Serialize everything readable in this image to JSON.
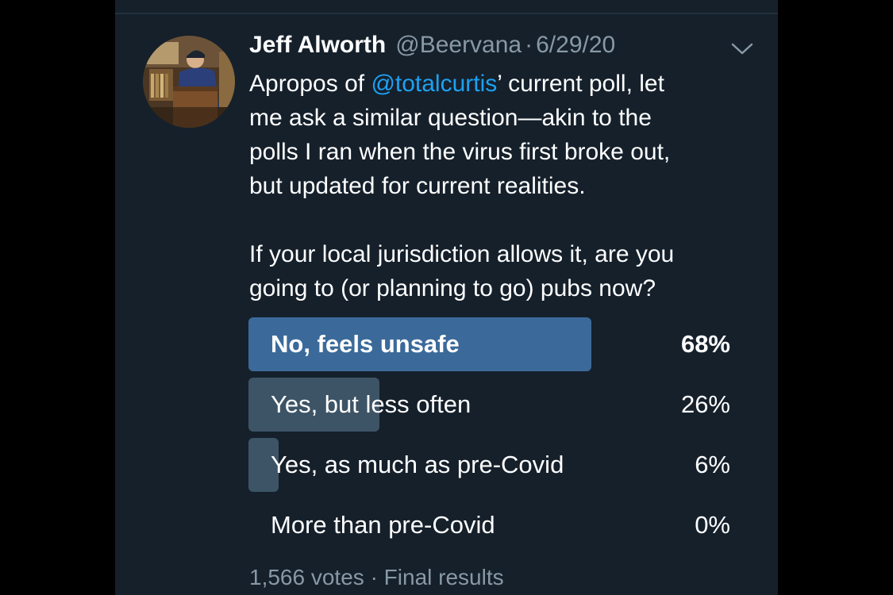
{
  "tweet": {
    "display_name": "Jeff Alworth",
    "handle": "@Beervana",
    "separator": "·",
    "date": "6/29/20",
    "avatar_icon": "user-avatar-photo",
    "menu_icon": "chevron-down-icon",
    "body": {
      "line1_before": "Apropos of ",
      "line1_mention": "@totalcurtis",
      "line1_after": "’ current poll, let",
      "line2": "me ask a similar question—akin to the",
      "line3": "polls I ran when the virus first broke out,",
      "line4": "but updated for current realities.",
      "line5": "If your local jurisdiction allows it, are you",
      "line6": "going to (or planning to go) pubs now?"
    }
  },
  "poll": {
    "options": [
      {
        "label": "No, feels unsafe",
        "percent_text": "68%",
        "share": 0.68,
        "winner": true
      },
      {
        "label": "Yes, but less often",
        "percent_text": "26%",
        "share": 0.26,
        "winner": false
      },
      {
        "label": "Yes, as much as pre-Covid",
        "percent_text": "6%",
        "share": 0.06,
        "winner": false
      },
      {
        "label": "More than pre-Covid",
        "percent_text": "0%",
        "share": 0.0,
        "winner": false
      }
    ],
    "votes": "1,566 votes",
    "meta_separator": "·",
    "status": "Final results"
  },
  "colors": {
    "background": "#15202b",
    "text": "#ffffff",
    "muted": "#8899a6",
    "link": "#1da1f2",
    "winner_bar": "#3b6a9a",
    "other_bar": "#3d5466"
  }
}
